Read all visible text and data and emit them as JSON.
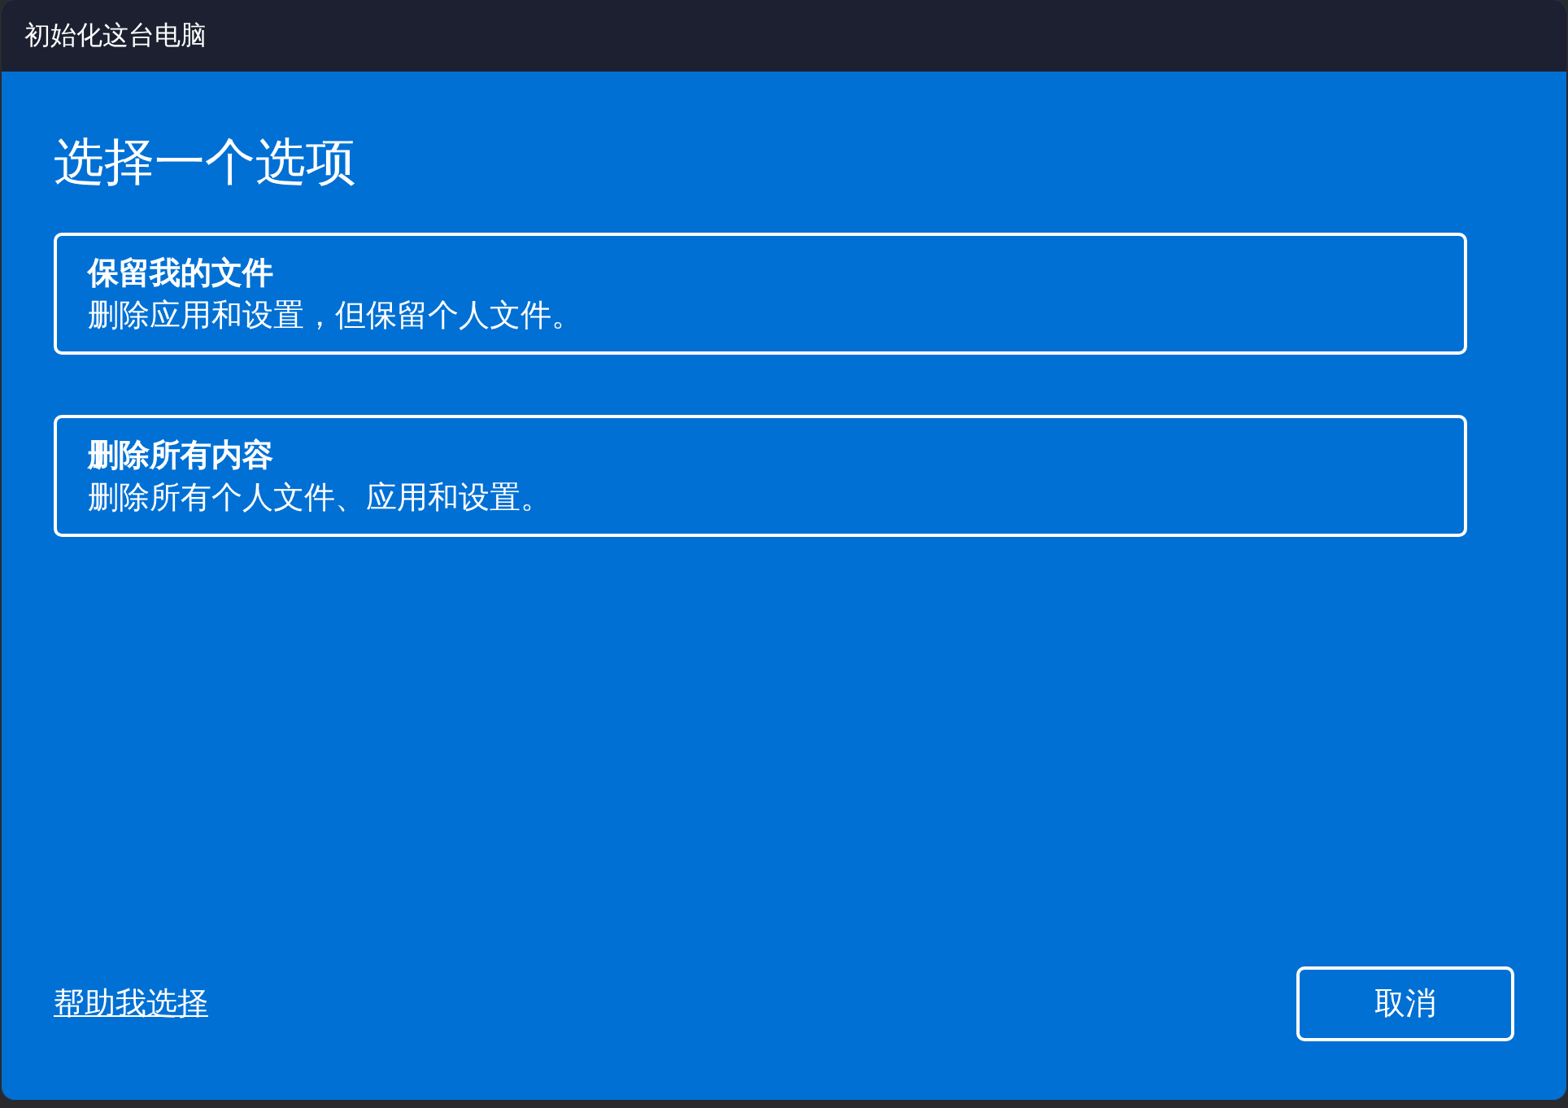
{
  "window": {
    "title": "初始化这台电脑"
  },
  "heading": "选择一个选项",
  "options": [
    {
      "title": "保留我的文件",
      "description": "删除应用和设置，但保留个人文件。"
    },
    {
      "title": "删除所有内容",
      "description": "删除所有个人文件、应用和设置。"
    }
  ],
  "help_link": "帮助我选择",
  "buttons": [
    "取消"
  ]
}
